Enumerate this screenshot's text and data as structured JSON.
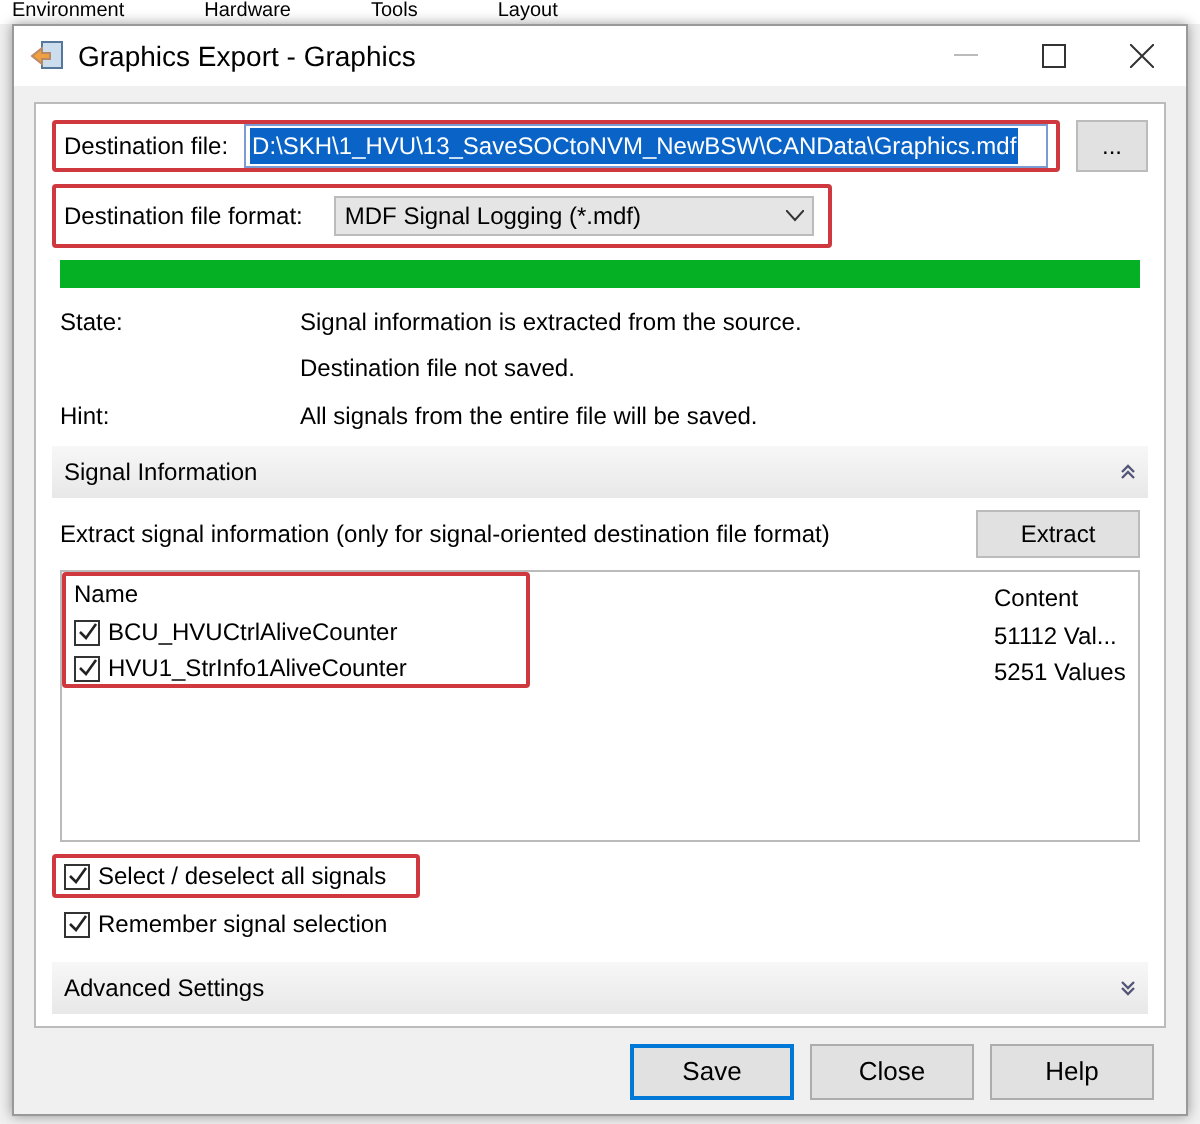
{
  "background_menu": [
    "Environment",
    "Hardware",
    "Tools",
    "Layout"
  ],
  "window": {
    "title": "Graphics Export - Graphics"
  },
  "destination_file": {
    "label": "Destination file:",
    "value": "D:\\SKH\\1_HVU\\13_SaveSOCtoNVM_NewBSW\\CANData\\Graphics.mdf",
    "selected": true,
    "annotated": true,
    "browse_button": "..."
  },
  "destination_format": {
    "label": "Destination file format:",
    "value": "MDF Signal Logging (*.mdf)",
    "annotated": true
  },
  "progress": {
    "level": 1
  },
  "info": [
    {
      "label": "State:",
      "lines": [
        "Signal information is extracted from the source.",
        "Destination file not saved."
      ]
    },
    {
      "label": "Hint:",
      "lines": [
        "All signals from the entire file will be saved."
      ]
    }
  ],
  "signal_section": {
    "title": "Signal Information",
    "expanded": true,
    "description": "Extract signal information (only for signal-oriented destination file format)",
    "extract_button": "Extract",
    "columns": [
      "Name",
      "Content"
    ],
    "annotated": true,
    "signals": [
      {
        "name": "BCU_HVUCtrlAliveCounter",
        "content": "51112 Val...",
        "checked": true
      },
      {
        "name": "HVU1_StrInfo1AliveCounter",
        "content": "5251 Values",
        "checked": true
      }
    ]
  },
  "options": [
    {
      "label": "Select / deselect all signals",
      "checked": true,
      "annotated": true
    },
    {
      "label": "Remember signal selection",
      "checked": true,
      "annotated": false
    }
  ],
  "advanced_section": {
    "title": "Advanced Settings",
    "expanded": false
  },
  "buttons": [
    {
      "label": "Save",
      "default": true
    },
    {
      "label": "Close",
      "default": false
    },
    {
      "label": "Help",
      "default": false
    }
  ]
}
